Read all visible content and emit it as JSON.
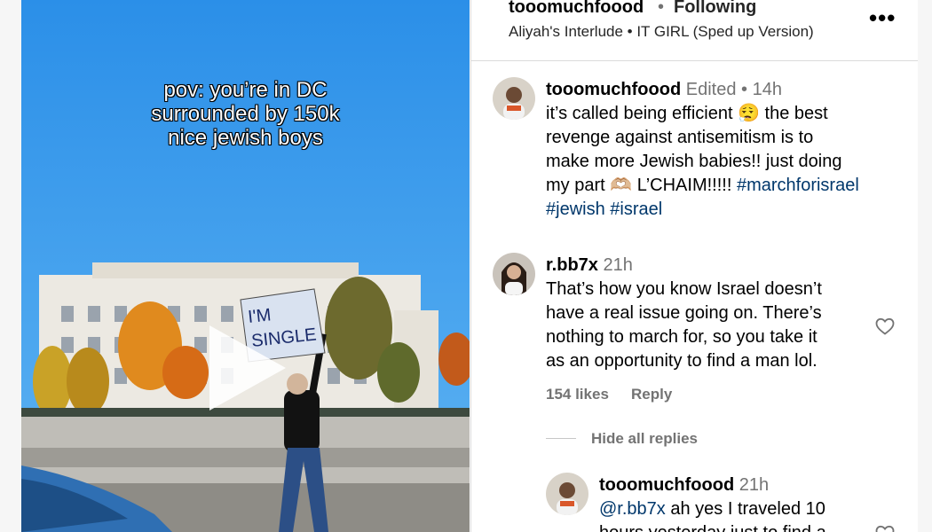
{
  "video": {
    "caption_lines": [
      "pov: you’re in DC",
      "surrounded by 150k",
      "nice jewish boys"
    ],
    "sign_text": [
      "I'M",
      "SINGLE"
    ]
  },
  "header": {
    "username": "tooomuchfoood",
    "separator": "•",
    "follow_status": "Following",
    "audio": "Aliyah's Interlude • IT GIRL (Sped up Version)",
    "more": "•••"
  },
  "caption_comment": {
    "username": "tooomuchfoood",
    "edited": "Edited",
    "dot": "•",
    "time": "14h",
    "text_lines": [
      "it’s called being efficient 😮‍💨 the best",
      "revenge against antisemitism is to",
      "make more Jewish babies!! just doing"
    ],
    "line4_text": "my part 🫶🏼 L’CHAIM!!!!! ",
    "hashtag1": "#marchforisrael",
    "hashtag2": "#jewish",
    "hashtag3": "#israel"
  },
  "comment1": {
    "username": "r.bb7x",
    "time": "21h",
    "text_lines": [
      "That’s how you know Israel doesn’t",
      "have a real issue going on. There’s",
      "nothing to march for, so you take it",
      "as an opportunity to find a man lol."
    ],
    "likes": "154 likes",
    "reply": "Reply",
    "hide_replies": "Hide all replies"
  },
  "reply1": {
    "username": "tooomuchfoood",
    "time": "21h",
    "mention": "@r.bb7x",
    "text_line1": " ah yes I traveled 10",
    "text_line2": "hours yesterday just to find a"
  },
  "colors": {
    "link": "#00376b",
    "meta": "#737373",
    "divider": "#dbdbdb",
    "sky": "#2f95ea"
  },
  "icons": [
    "more-options-icon",
    "play-icon",
    "heart-icon",
    "avatar-image"
  ]
}
